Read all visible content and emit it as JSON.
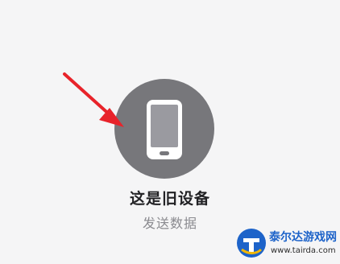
{
  "device_option": {
    "title": "这是旧设备",
    "subtitle": "发送数据",
    "icon": "phone-icon",
    "circle_color": "#77777b"
  },
  "annotation": {
    "icon": "arrow-icon",
    "color": "#e8232a"
  },
  "watermark": {
    "brand": "泰尔达游戏网",
    "url": "www.tairda.com",
    "icon": "logo-icon"
  }
}
